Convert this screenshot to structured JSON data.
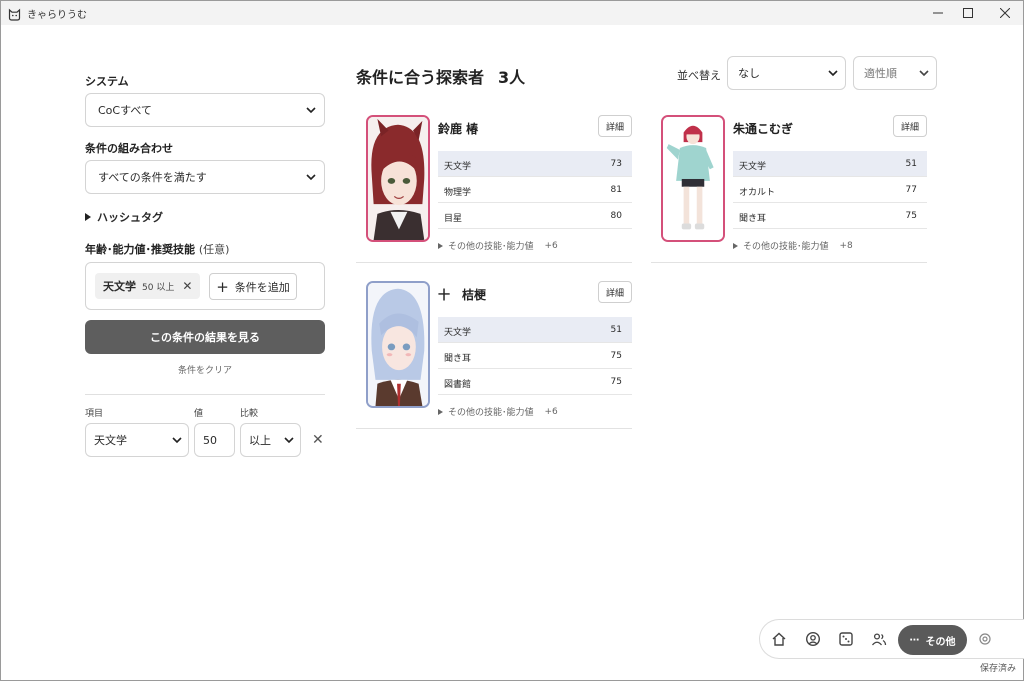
{
  "window": {
    "title": "きゃらりうむ"
  },
  "filters": {
    "system_label": "システム",
    "system_value": "CoCすべて",
    "combine_label": "条件の組み合わせ",
    "combine_value": "すべての条件を満たす",
    "hashtag_label": "ハッシュタグ",
    "stats_label": "年齢･能力値･推奨技能",
    "stats_optional": "(任意)",
    "chip": {
      "key": "天文学",
      "value": "50 以上",
      "remove": "✕"
    },
    "add_condition": "条件を追加",
    "show_results": "この条件の結果を見る",
    "clear": "条件をクリア",
    "editor": {
      "item_label": "項目",
      "item_value": "天文学",
      "value_label": "値",
      "value_value": "50",
      "compare_label": "比較",
      "compare_value": "以上",
      "remove": "✕"
    }
  },
  "results": {
    "heading": "条件に合う探索者",
    "count": "3人",
    "sort_label": "並べ替え",
    "sort_value": "なし",
    "sort_order": "適性順"
  },
  "cards": [
    {
      "name": "鈴鹿 椿",
      "detail": "詳細",
      "border": "#d4507a",
      "stats": [
        {
          "k": "天文学",
          "v": "73"
        },
        {
          "k": "物理学",
          "v": "81"
        },
        {
          "k": "目星",
          "v": "80"
        }
      ],
      "more": "その他の技能･能力値",
      "more_count": "+6"
    },
    {
      "name": "朱通こむぎ",
      "detail": "詳細",
      "border": "#d4507a",
      "stats": [
        {
          "k": "天文学",
          "v": "51"
        },
        {
          "k": "オカルト",
          "v": "77"
        },
        {
          "k": "聞き耳",
          "v": "75"
        }
      ],
      "more": "その他の技能･能力値",
      "more_count": "+8"
    },
    {
      "name": "十　桔梗",
      "detail": "詳細",
      "border": "#8f9fc9",
      "stats": [
        {
          "k": "天文学",
          "v": "51"
        },
        {
          "k": "聞き耳",
          "v": "75"
        },
        {
          "k": "図書館",
          "v": "75"
        }
      ],
      "more": "その他の技能･能力値",
      "more_count": "+6"
    }
  ],
  "nav": {
    "other": "その他",
    "saved": "保存済み"
  }
}
